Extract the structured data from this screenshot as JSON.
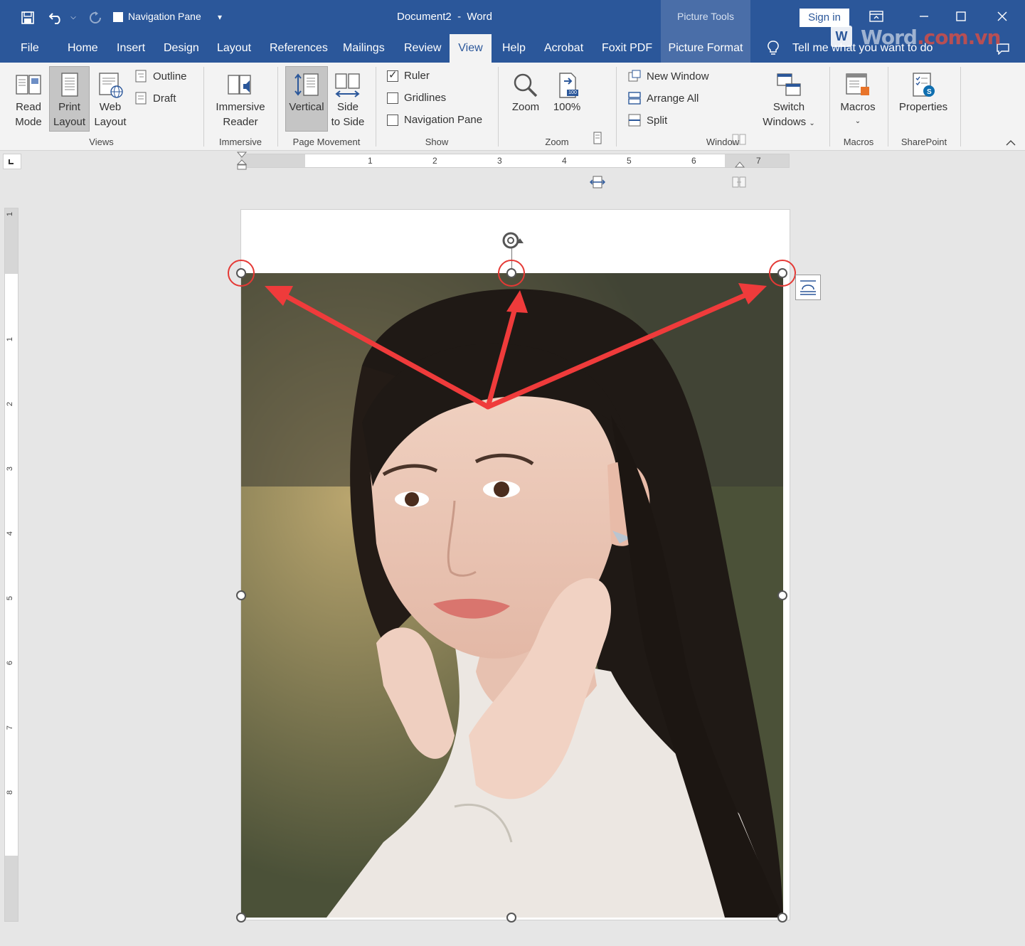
{
  "qat": {
    "navpane_label": "Navigation Pane",
    "save_icon": "save-icon",
    "undo_icon": "undo-icon",
    "redo_icon": "redo-icon"
  },
  "title": {
    "doc": "Document2",
    "sep": "-",
    "app": "Word",
    "picture_tools": "Picture Tools",
    "signin": "Sign in"
  },
  "tabs": [
    "File",
    "Home",
    "Insert",
    "Design",
    "Layout",
    "References",
    "Mailings",
    "Review",
    "View",
    "Help",
    "Acrobat",
    "Foxit PDF",
    "Picture Format"
  ],
  "tellme": "Tell me what you want to do",
  "watermark": {
    "logo": "W",
    "text": "Word",
    "domain": ".com.vn"
  },
  "ribbon": {
    "views": {
      "read_mode": [
        "Read",
        "Mode"
      ],
      "print_layout": [
        "Print",
        "Layout"
      ],
      "web_layout": [
        "Web",
        "Layout"
      ],
      "outline": "Outline",
      "draft": "Draft",
      "label": "Views"
    },
    "immersive": {
      "reader": [
        "Immersive",
        "Reader"
      ],
      "label": "Immersive"
    },
    "page_movement": {
      "vertical": "Vertical",
      "side": [
        "Side",
        "to Side"
      ],
      "label": "Page Movement"
    },
    "show": {
      "ruler": "Ruler",
      "gridlines": "Gridlines",
      "navigation_pane": "Navigation Pane",
      "label": "Show"
    },
    "zoom": {
      "zoom": "Zoom",
      "percent": "100%",
      "badge": "100",
      "label": "Zoom"
    },
    "window": {
      "new_window": "New Window",
      "arrange_all": "Arrange All",
      "split": "Split",
      "switch": [
        "Switch",
        "Windows"
      ],
      "label": "Window"
    },
    "macros": {
      "macros": "Macros",
      "label": "Macros"
    },
    "sharepoint": {
      "properties": "Properties",
      "label": "SharePoint"
    }
  },
  "ruler_numbers": [
    "1",
    "2",
    "3",
    "4",
    "5",
    "6",
    "7"
  ],
  "vruler_numbers": [
    "1",
    "1",
    "2",
    "3",
    "4",
    "5",
    "6",
    "7",
    "8"
  ],
  "colors": {
    "brand": "#2b579a",
    "annotation": "#e53935"
  }
}
